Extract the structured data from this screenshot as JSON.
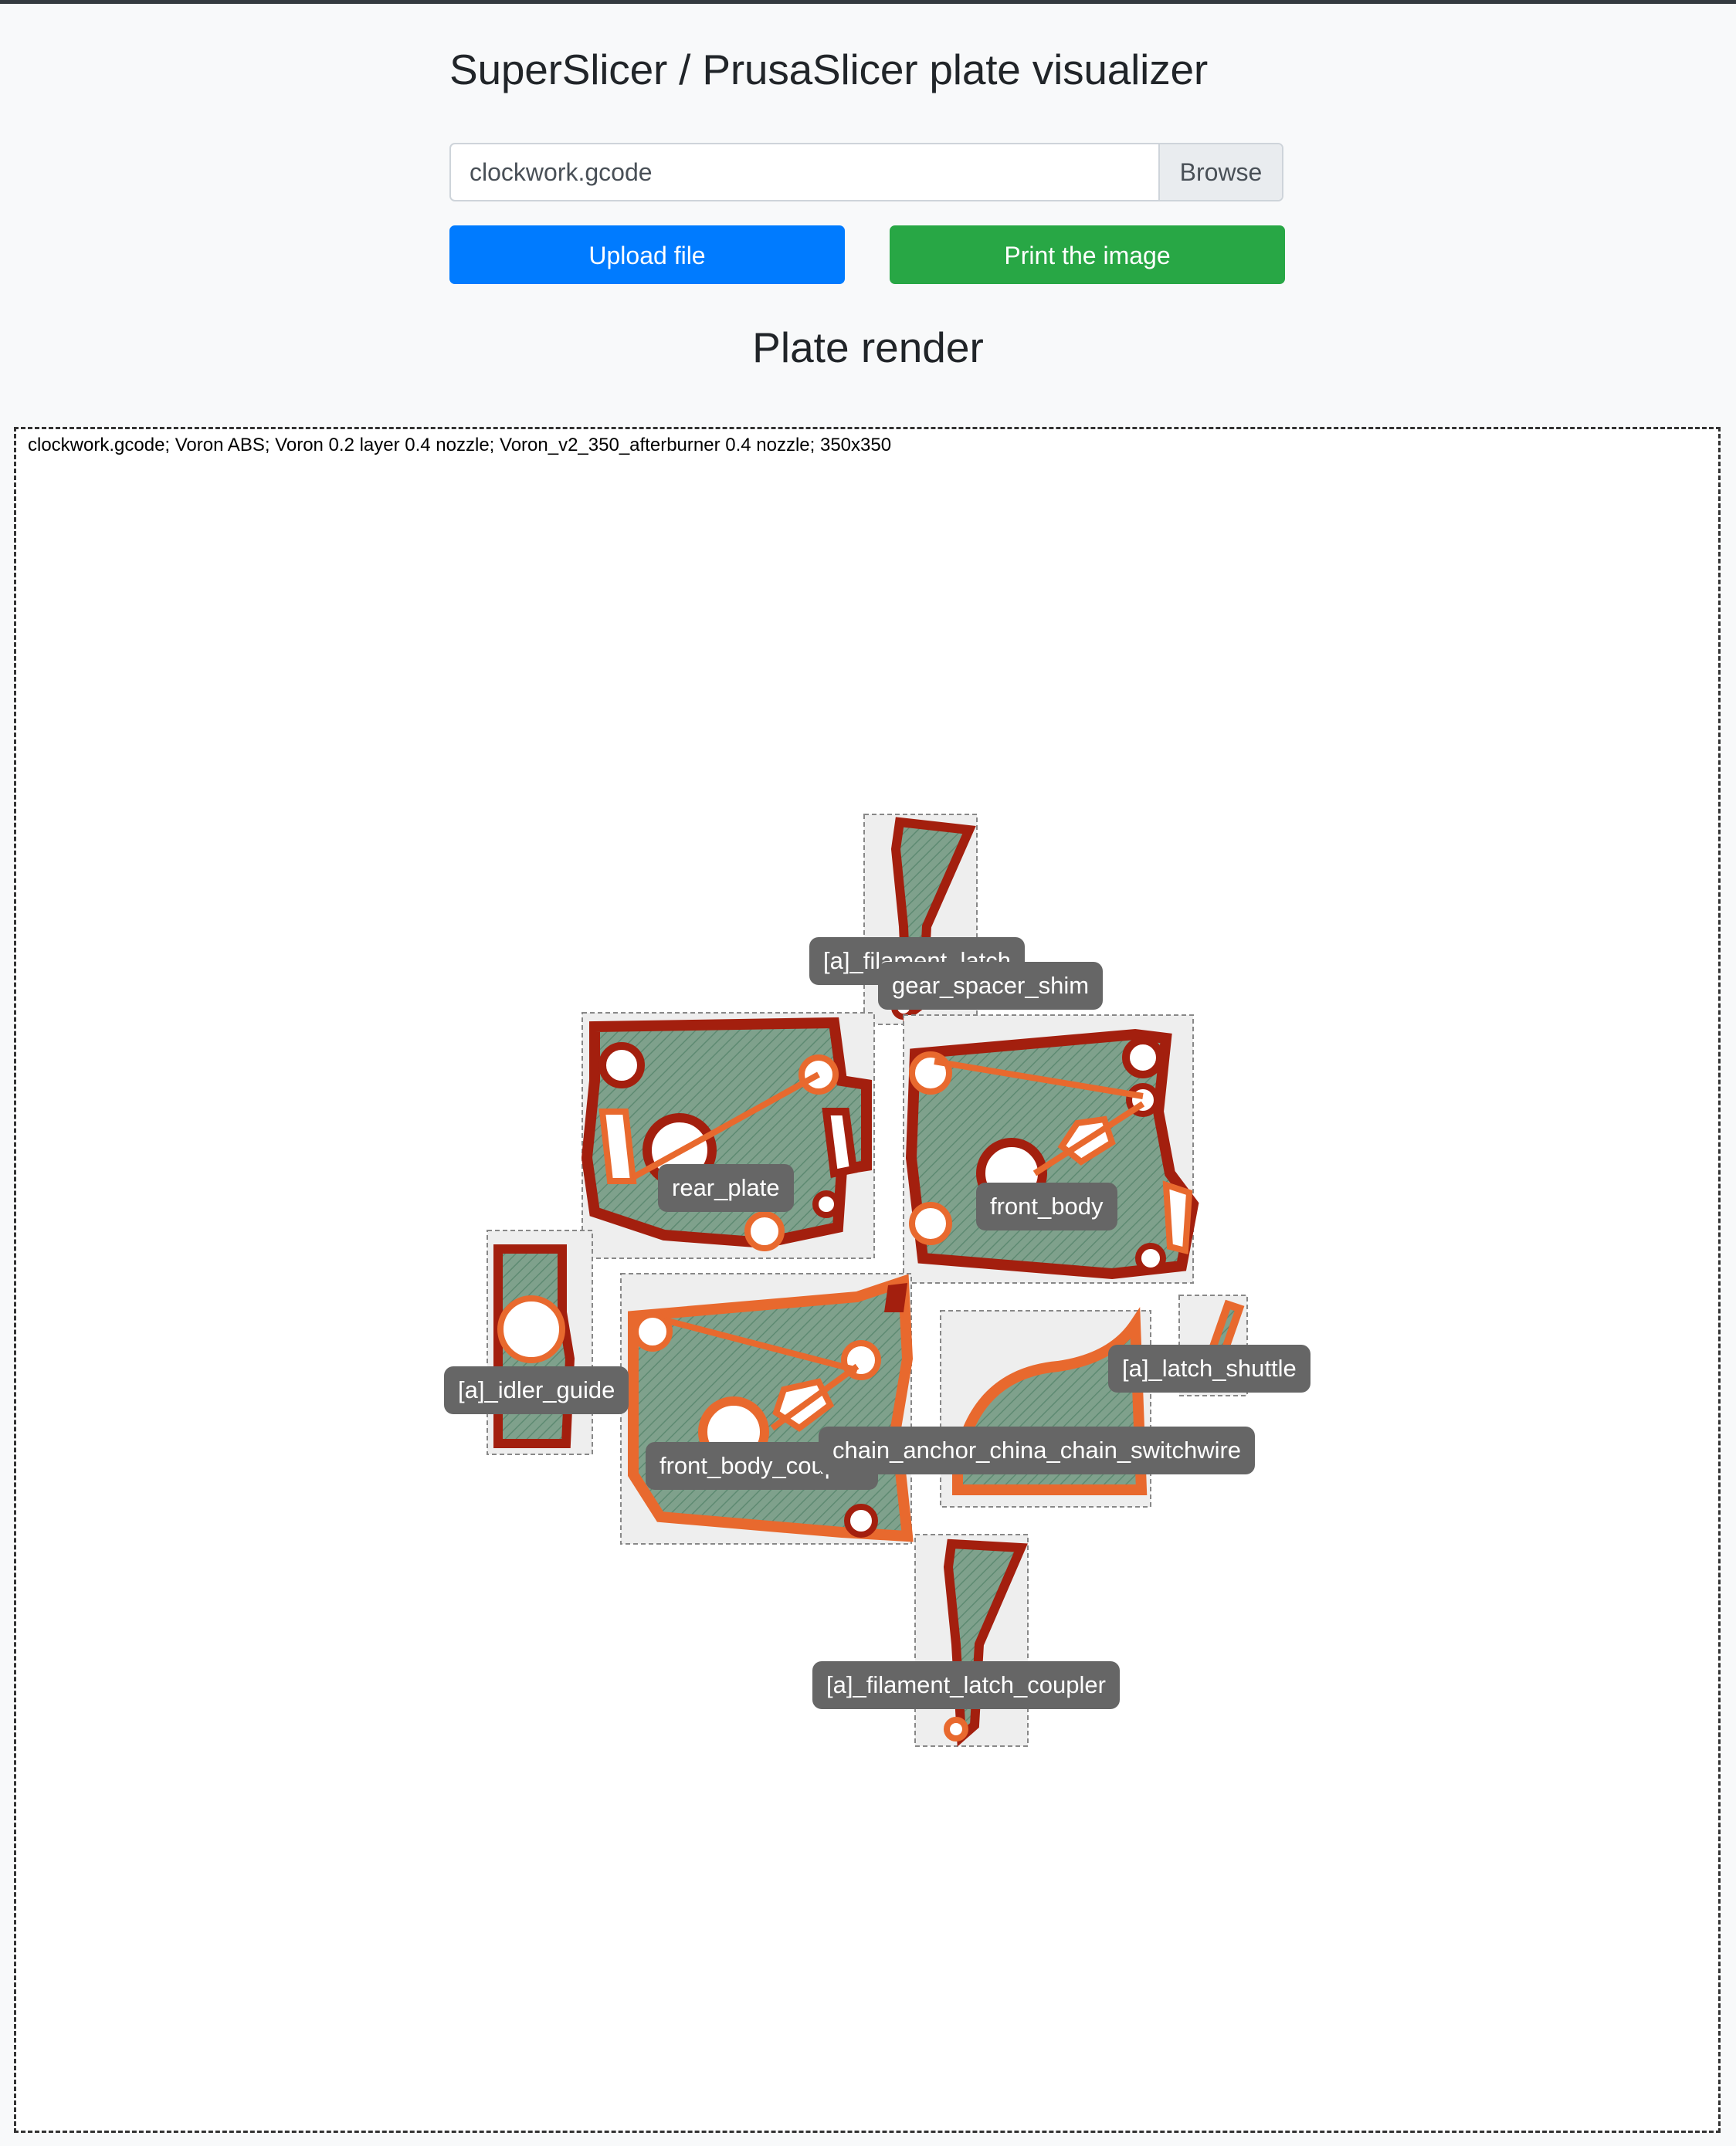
{
  "header": {
    "title": "SuperSlicer / PrusaSlicer plate visualizer"
  },
  "form": {
    "file_value": "clockwork.gcode",
    "browse_label": "Browse",
    "upload_label": "Upload file",
    "print_label": "Print the image"
  },
  "render": {
    "heading": "Plate render",
    "info": "clockwork.gcode; Voron ABS; Voron 0.2 layer 0.4 nozzle; Voron_v2_350_afterburner 0.4 nozzle; 350x350",
    "objects": [
      {
        "name": "[a]_filament_latch"
      },
      {
        "name": "gear_spacer_shim"
      },
      {
        "name": "rear_plate"
      },
      {
        "name": "front_body"
      },
      {
        "name": "[a]_idler_guide"
      },
      {
        "name": "front_body_coupler"
      },
      {
        "name": "chain_anchor_china_chain_switchwire"
      },
      {
        "name": "[a]_latch_shuttle"
      },
      {
        "name": "[a]_filament_latch_coupler"
      }
    ]
  },
  "colors": {
    "perimeter_outer": "#a31f0e",
    "perimeter_external": "#e8692e",
    "infill": "#7fa18c",
    "bbox_fill": "#eeeeee",
    "label_bg": "#666666",
    "upload_btn": "#007bff",
    "print_btn": "#28a745"
  }
}
